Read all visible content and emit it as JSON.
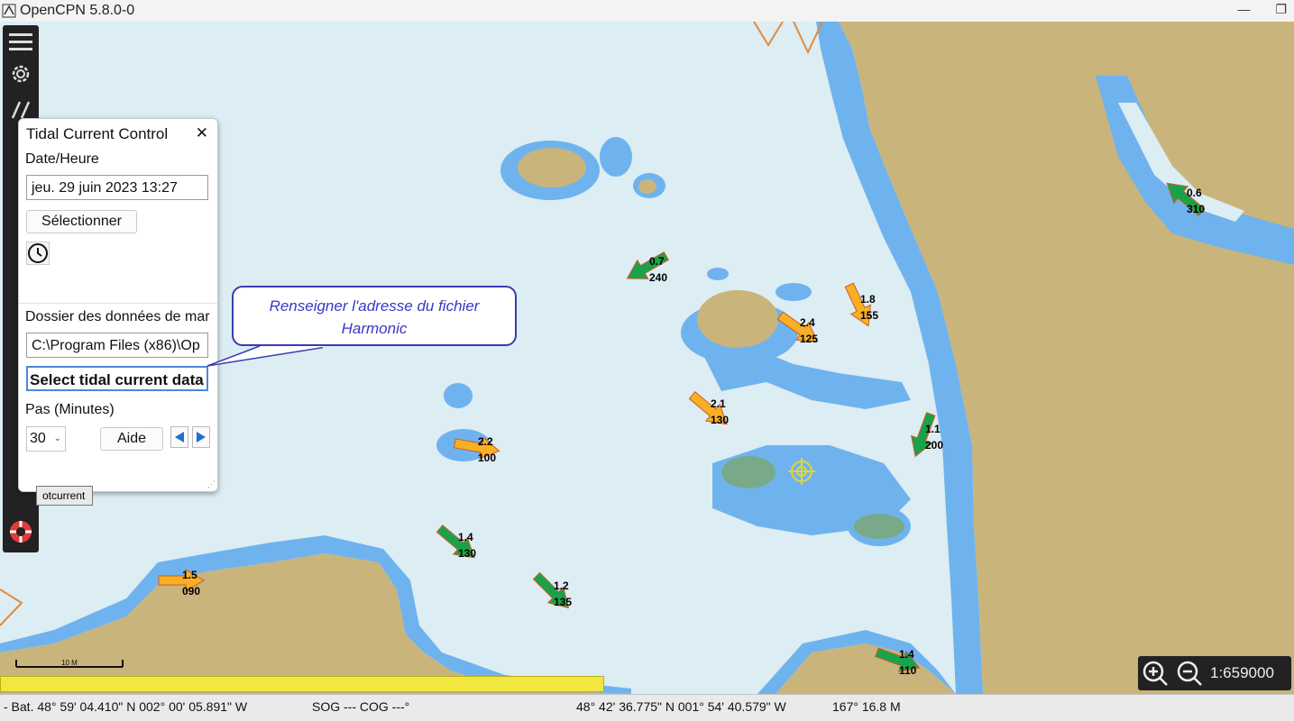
{
  "window": {
    "title": "OpenCPN 5.8.0-0"
  },
  "dialog": {
    "title": "Tidal Current Control",
    "date_label": "Date/Heure",
    "date_value": "jeu. 29 juin 2023 13:27",
    "select_button": "Sélectionner",
    "folder_label": "Dossier des données de mar",
    "folder_value": "C:\\Program Files (x86)\\Op",
    "select_data_button": "Select tidal current data",
    "step_label": "Pas (Minutes)",
    "step_value": "30",
    "help_button": "Aide"
  },
  "callout": {
    "text_line1": "Renseigner l'adresse du fichier",
    "text_line2": "Harmonic"
  },
  "tooltip": {
    "text": "otcurrent"
  },
  "scale": {
    "value": "1:659000",
    "bar_label": "10 M"
  },
  "status": {
    "boat": "- Bat. 48° 59' 04.410\" N   002° 00' 05.891\" W",
    "sog_cog": "SOG --- COG ---°",
    "cursor": "48° 42' 36.775\" N   001° 54' 40.579\" W",
    "bearing_dist": "167°  16.8 M"
  },
  "colors": {
    "land": "#c9b47c",
    "shallow": "#6fb3ee",
    "deep": "#dcedf3",
    "green_arrow": "#1aa24a",
    "orange_arrow": "#f7b024"
  },
  "currents": [
    {
      "speed": "0.7",
      "dir": "240",
      "color": "green",
      "angle": 240
    },
    {
      "speed": "0.6",
      "dir": "310",
      "color": "green",
      "angle": 310
    },
    {
      "speed": "1.8",
      "dir": "155",
      "color": "orange",
      "angle": 155
    },
    {
      "speed": "2.4",
      "dir": "125",
      "color": "orange",
      "angle": 125
    },
    {
      "speed": "2.1",
      "dir": "130",
      "color": "orange",
      "angle": 130
    },
    {
      "speed": "1.1",
      "dir": "200",
      "color": "green",
      "angle": 200
    },
    {
      "speed": "2.2",
      "dir": "100",
      "color": "orange",
      "angle": 100
    },
    {
      "speed": "1.4",
      "dir": "130",
      "color": "green",
      "angle": 130
    },
    {
      "speed": "1.2",
      "dir": "135",
      "color": "green",
      "angle": 135
    },
    {
      "speed": "1.5",
      "dir": "090",
      "color": "orange",
      "angle": 90
    },
    {
      "speed": "1.4",
      "dir": "110",
      "color": "green",
      "angle": 110
    }
  ]
}
